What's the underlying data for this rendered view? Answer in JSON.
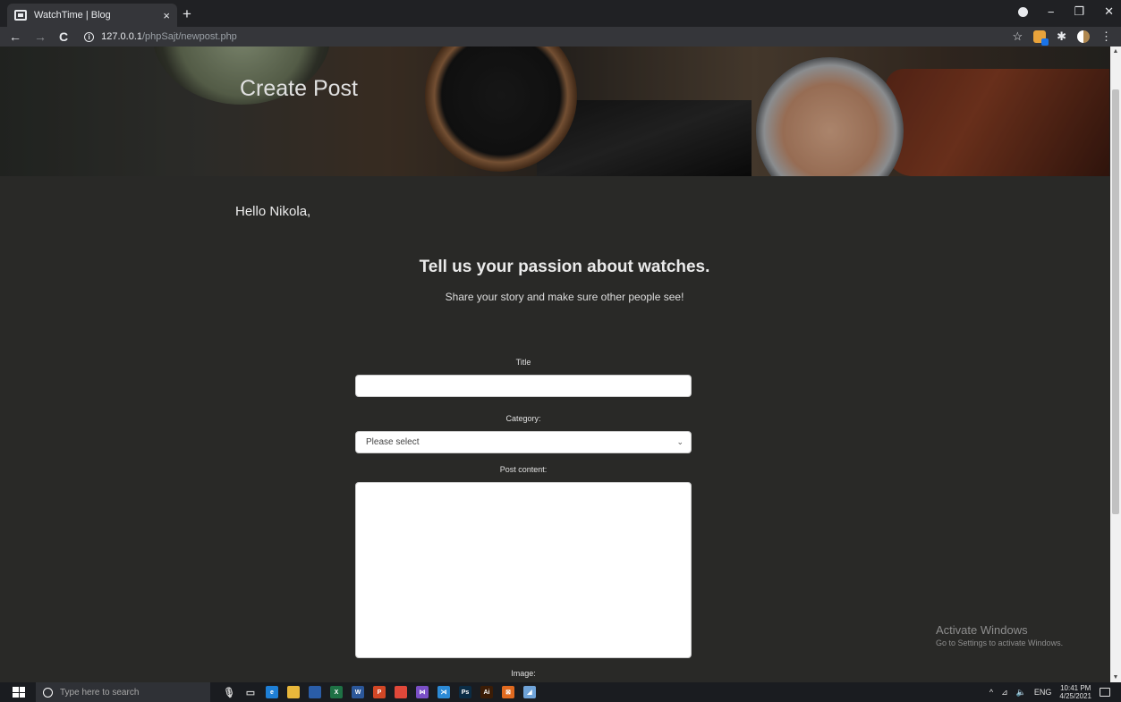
{
  "browser": {
    "tab_title": "WatchTime | Blog",
    "tab_close": "×",
    "new_tab": "+",
    "url_host": "127.0.0.1",
    "url_path": "/phpSajt/newpost.php",
    "nav": {
      "back": "←",
      "forward": "→",
      "reload": "C"
    },
    "info_glyph": "i",
    "window": {
      "minimize": "−",
      "maximize": "❐",
      "close": "✕"
    },
    "toolbar_icons": {
      "bookmark": "☆",
      "extensions": "✱",
      "menu": "⋮"
    }
  },
  "page": {
    "hero_title": "Create Post",
    "greeting": "Hello Nikola,",
    "heading": "Tell us your passion about watches.",
    "subheading": "Share your story and make sure other people see!",
    "form": {
      "title_label": "Title",
      "title_value": "",
      "category_label": "Category:",
      "category_selected": "Please select",
      "category_chevron": "⌄",
      "content_label": "Post content:",
      "content_value": "",
      "image_label": "Image:"
    },
    "watermark": {
      "line1": "Activate Windows",
      "line2": "Go to Settings to activate Windows."
    },
    "scroll_up": "▲",
    "scroll_down": "▼"
  },
  "taskbar": {
    "search_placeholder": "Type here to search",
    "apps": [
      {
        "icon": "microphone-icon",
        "glyph": "🎙",
        "color": ""
      },
      {
        "icon": "task-view-icon",
        "glyph": "▭",
        "color": ""
      },
      {
        "icon": "edge-icon",
        "glyph": "e",
        "color": "#1e7fd6"
      },
      {
        "icon": "file-explorer-icon",
        "glyph": "",
        "color": "#e8b73b"
      },
      {
        "icon": "save-icon",
        "glyph": "",
        "color": "#2a5da8"
      },
      {
        "icon": "excel-icon",
        "glyph": "X",
        "color": "#1e7145"
      },
      {
        "icon": "word-icon",
        "glyph": "W",
        "color": "#2b579a"
      },
      {
        "icon": "powerpoint-icon",
        "glyph": "P",
        "color": "#d24726"
      },
      {
        "icon": "chrome-icon",
        "glyph": "",
        "color": "#e0483a"
      },
      {
        "icon": "visual-studio-icon",
        "glyph": "⋈",
        "color": "#7a4fc6"
      },
      {
        "icon": "vscode-icon",
        "glyph": "⋊",
        "color": "#2c8ad6"
      },
      {
        "icon": "photoshop-icon",
        "glyph": "Ps",
        "color": "#0b2c45"
      },
      {
        "icon": "illustrator-icon",
        "glyph": "Ai",
        "color": "#3b1c06"
      },
      {
        "icon": "xampp-icon",
        "glyph": "⊠",
        "color": "#e06a20"
      },
      {
        "icon": "unknown-app-icon",
        "glyph": "◢",
        "color": "#6fa3d8"
      }
    ],
    "tray": {
      "chevron": "^",
      "network": "⊿",
      "volume": "🔈",
      "language": "ENG",
      "time": "10:41 PM",
      "date": "4/25/2021"
    }
  }
}
